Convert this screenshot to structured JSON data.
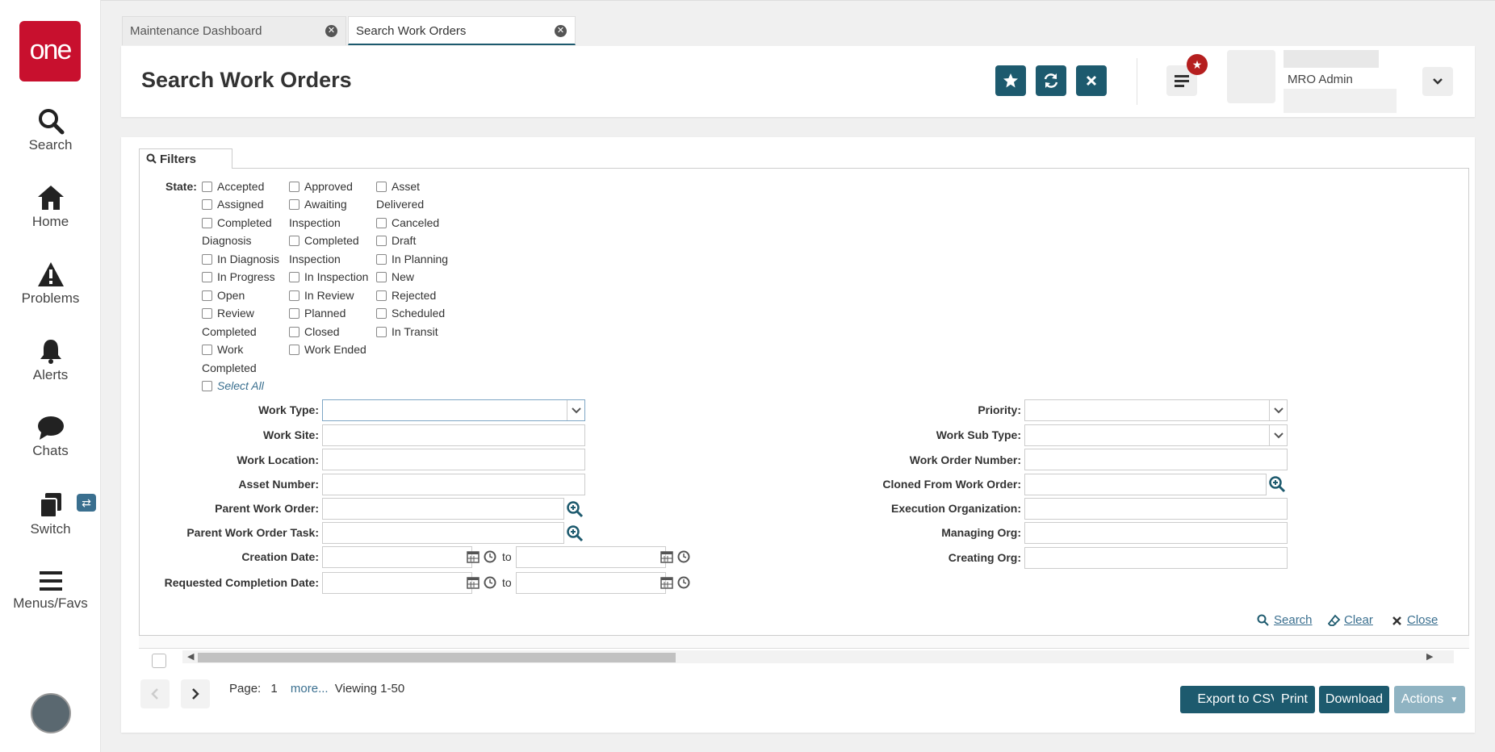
{
  "sidebar": {
    "logo_text": "one",
    "items": [
      {
        "label": "Search",
        "icon": "search-icon"
      },
      {
        "label": "Home",
        "icon": "home-icon"
      },
      {
        "label": "Problems",
        "icon": "warning-icon"
      },
      {
        "label": "Alerts",
        "icon": "bell-icon"
      },
      {
        "label": "Chats",
        "icon": "chat-icon"
      },
      {
        "label": "Switch",
        "icon": "switch-icon"
      },
      {
        "label": "Menus/Favs",
        "icon": "menu-icon"
      }
    ]
  },
  "tabs": [
    {
      "label": "Maintenance Dashboard",
      "active": false
    },
    {
      "label": "Search Work Orders",
      "active": true
    }
  ],
  "header": {
    "title": "Search Work Orders",
    "user_role": "MRO Admin"
  },
  "filters": {
    "tab_label": "Filters",
    "state_label": "State:",
    "state_col1": [
      "Accepted",
      "Assigned",
      "Completed",
      "Diagnosis",
      "In Diagnosis",
      "In Progress",
      "Open",
      "Review",
      "Completed",
      "Work",
      "Completed"
    ],
    "state_col2": [
      "Approved",
      "Awaiting",
      "Inspection",
      "Completed",
      "Inspection",
      "In Inspection",
      "In Review",
      "Planned",
      "Closed",
      "Work Ended"
    ],
    "state_col3": [
      "Asset",
      "Delivered",
      "Canceled",
      "Draft",
      "In Planning",
      "New",
      "Rejected",
      "Scheduled",
      "In Transit"
    ],
    "select_all": "Select All",
    "left_fields": {
      "work_type": "Work Type:",
      "work_site": "Work Site:",
      "work_location": "Work Location:",
      "asset_number": "Asset Number:",
      "parent_work_order": "Parent Work Order:",
      "parent_work_order_task": "Parent Work Order Task:",
      "creation_date": "Creation Date:",
      "requested_completion_date": "Requested Completion Date:"
    },
    "right_fields": {
      "priority": "Priority:",
      "work_sub_type": "Work Sub Type:",
      "work_order_number": "Work Order Number:",
      "cloned_from_work_order": "Cloned From Work Order:",
      "execution_organization": "Execution Organization:",
      "managing_org": "Managing Org:",
      "creating_org": "Creating Org:"
    },
    "to_text": "to",
    "actions": {
      "search": "Search",
      "clear": "Clear",
      "close": "Close"
    }
  },
  "pager": {
    "page_label": "Page:",
    "page_number": "1",
    "more": "more...",
    "viewing": "Viewing 1-50"
  },
  "buttons": {
    "export_csv": "Export to CSV",
    "print": "Print",
    "download": "Download",
    "actions": "Actions"
  },
  "colors": {
    "brand": "#c8102e",
    "primary": "#1d5a6e",
    "link": "#3a6f8f"
  }
}
